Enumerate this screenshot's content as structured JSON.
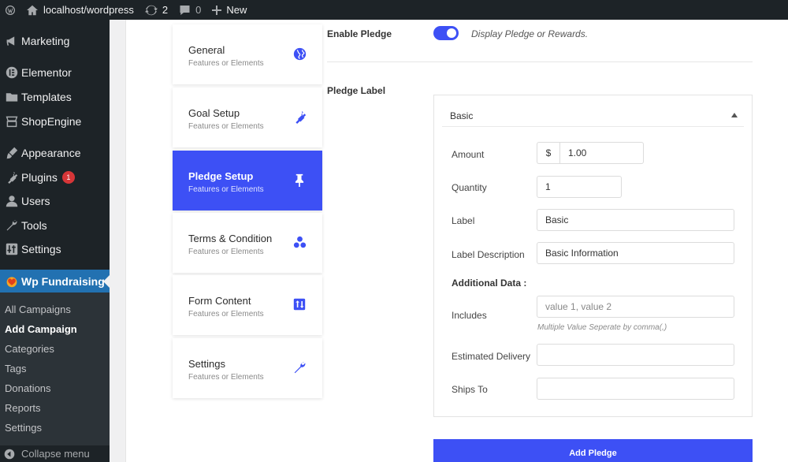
{
  "adminbar": {
    "site": "localhost/wordpress",
    "updates": "2",
    "comments": "0",
    "new_label": "New"
  },
  "sidebar": {
    "items": [
      {
        "label": "Marketing"
      },
      {
        "label": "Elementor"
      },
      {
        "label": "Templates"
      },
      {
        "label": "ShopEngine"
      },
      {
        "label": "Appearance"
      },
      {
        "label": "Plugins",
        "badge": "1"
      },
      {
        "label": "Users"
      },
      {
        "label": "Tools"
      },
      {
        "label": "Settings"
      },
      {
        "label": "Wp Fundraising"
      }
    ],
    "submenu": [
      "All Campaigns",
      "Add Campaign",
      "Categories",
      "Tags",
      "Donations",
      "Reports",
      "Settings"
    ],
    "collapse": "Collapse menu"
  },
  "tabs": [
    {
      "title": "General",
      "sub": "Features or Elements",
      "icon": "globe-icon"
    },
    {
      "title": "Goal Setup",
      "sub": "Features or Elements",
      "icon": "plug-icon"
    },
    {
      "title": "Pledge Setup",
      "sub": "Features or Elements",
      "icon": "pin-icon"
    },
    {
      "title": "Terms & Condition",
      "sub": "Features or Elements",
      "icon": "circles-icon"
    },
    {
      "title": "Form Content",
      "sub": "Features or Elements",
      "icon": "sort-icon"
    },
    {
      "title": "Settings",
      "sub": "Features or Elements",
      "icon": "wrench-icon"
    }
  ],
  "form": {
    "enable_label": "Enable Pledge",
    "enable_desc": "Display Pledge or Rewards.",
    "pledge_label": "Pledge Label",
    "box_title": "Basic",
    "amount_label": "Amount",
    "currency": "$",
    "amount_value": "1.00",
    "quantity_label": "Quantity",
    "quantity_value": "1",
    "label_label": "Label",
    "label_value": "Basic",
    "desc_label": "Label Description",
    "desc_value": "Basic Information",
    "additional": "Additional Data :",
    "includes_label": "Includes",
    "includes_placeholder": "value 1, value 2",
    "includes_hint": "Multiple Value Seperate by comma(,)",
    "delivery_label": "Estimated Delivery",
    "delivery_value": "",
    "ships_label": "Ships To",
    "ships_value": "",
    "add_button": "Add Pledge"
  },
  "colors": {
    "accent": "#3d50f5",
    "admin_dark": "#1d2327",
    "wp_blue": "#2271b1"
  }
}
